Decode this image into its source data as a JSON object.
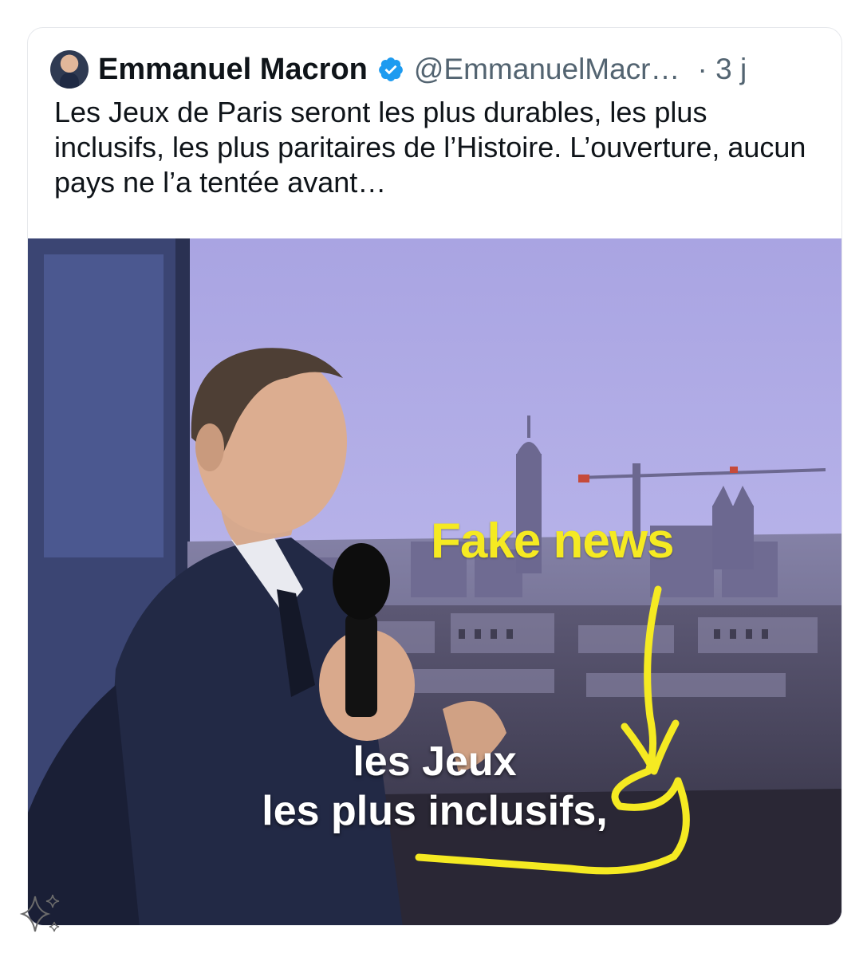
{
  "tweet": {
    "author_name": "Emmanuel Macron",
    "handle": "@EmmanuelMacr…",
    "time": "· 3 j",
    "text": "Les Jeux de Paris seront les plus durables, les plus inclusifs, les plus paritaires de l’Histoire. L’ouverture, aucun pays ne l’a tentée avant…"
  },
  "media": {
    "caption_line1": "les Jeux",
    "caption_line2": "les plus inclusifs,",
    "annotation": "Fake news",
    "annotation_color": "#f5ea22"
  },
  "colors": {
    "verified_badge": "#1d9bf0",
    "text_primary": "#0f1419",
    "text_secondary": "#536471",
    "sky": "#b3aee6"
  },
  "icons": {
    "verified": "verified-badge-icon",
    "sparkle": "sparkle-icon"
  }
}
